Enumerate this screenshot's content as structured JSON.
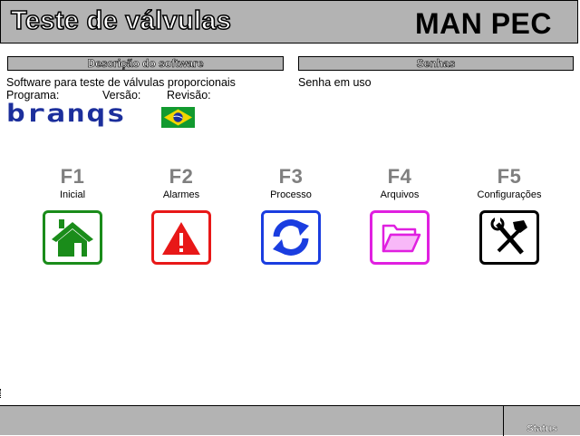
{
  "header": {
    "title": "Teste de válvulas",
    "brand": "MAN PEC"
  },
  "description": {
    "heading": "Descrição do software",
    "text": "Software para teste de válvulas proporcionais",
    "programa_label": "Programa:",
    "versao_label": "Versão:",
    "revisao_label": "Revisão:",
    "logo_text": "branqs",
    "flag_icon": "brazil-flag-icon"
  },
  "senhas": {
    "heading": "Senhas",
    "text": "Senha em uso"
  },
  "function_keys": [
    {
      "key": "F1",
      "label": "Inicial",
      "icon": "home-icon",
      "color": "#1a8c1a"
    },
    {
      "key": "F2",
      "label": "Alarmes",
      "icon": "warning-icon",
      "color": "#e81818"
    },
    {
      "key": "F3",
      "label": "Processo",
      "icon": "refresh-icon",
      "color": "#1a3de0"
    },
    {
      "key": "F4",
      "label": "Arquivos",
      "icon": "folder-icon",
      "color": "#e020e0"
    },
    {
      "key": "F5",
      "label": "Configurações",
      "icon": "tools-icon",
      "color": "#000000"
    }
  ],
  "footer": {
    "status_label": "Status"
  }
}
